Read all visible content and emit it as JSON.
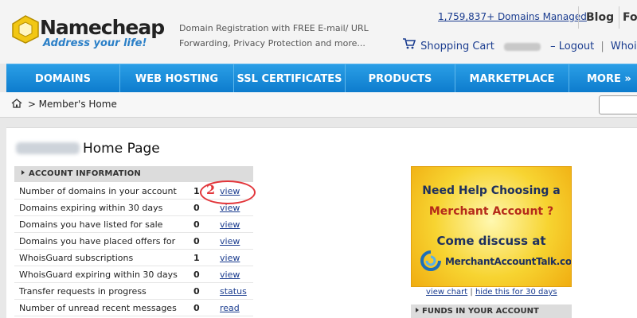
{
  "header": {
    "logo_name": "Namecheap",
    "logo_tagline": "Address your life!",
    "promo_line1": "Domain Registration with FREE E-mail/ URL",
    "promo_line2": "Forwarding, Privacy Protection and more...",
    "domains_managed": "1,759,837+ Domains Managed",
    "blog": "Blog",
    "fo": "Fo",
    "cart": "Shopping Cart",
    "logout": "– Logout",
    "whois": "Whois"
  },
  "nav": {
    "items": [
      "DOMAINS",
      "WEB HOSTING",
      "SSL CERTIFICATES",
      "PRODUCTS",
      "MARKETPLACE",
      "MORE »"
    ]
  },
  "breadcrumb": {
    "text": " > Member's Home"
  },
  "page": {
    "title": "Home Page"
  },
  "account": {
    "heading": "ACCOUNT INFORMATION",
    "rows": [
      {
        "label": "Number of domains in your account",
        "count": "1",
        "link": "view"
      },
      {
        "label": "Domains expiring within 30 days",
        "count": "0",
        "link": "view"
      },
      {
        "label": "Domains you have listed for sale",
        "count": "0",
        "link": "view"
      },
      {
        "label": "Domains you have placed offers for",
        "count": "0",
        "link": "view"
      },
      {
        "label": "WhoisGuard subscriptions",
        "count": "1",
        "link": "view"
      },
      {
        "label": "WhoisGuard expiring within 30 days",
        "count": "0",
        "link": "view"
      },
      {
        "label": "Transfer requests in progress",
        "count": "0",
        "link": "status"
      },
      {
        "label": "Number of unread recent messages",
        "count": "0",
        "link": "read"
      }
    ]
  },
  "annotation": {
    "number": "2",
    "color": "#e2353a"
  },
  "ad": {
    "line1": "Need Help Choosing a",
    "line2": "Merchant Account ?",
    "line3": "Come discuss at",
    "line4": "MerchantAccountTalk.com",
    "view_chart": "view chart",
    "separator": " | ",
    "hide": "hide this for 30 days"
  },
  "funds": {
    "heading": "FUNDS IN YOUR ACCOUNT"
  },
  "colors": {
    "nav_blue": "#1a8ad8",
    "link_blue": "#1a3c8f",
    "ad_yellow": "#f7d431"
  }
}
